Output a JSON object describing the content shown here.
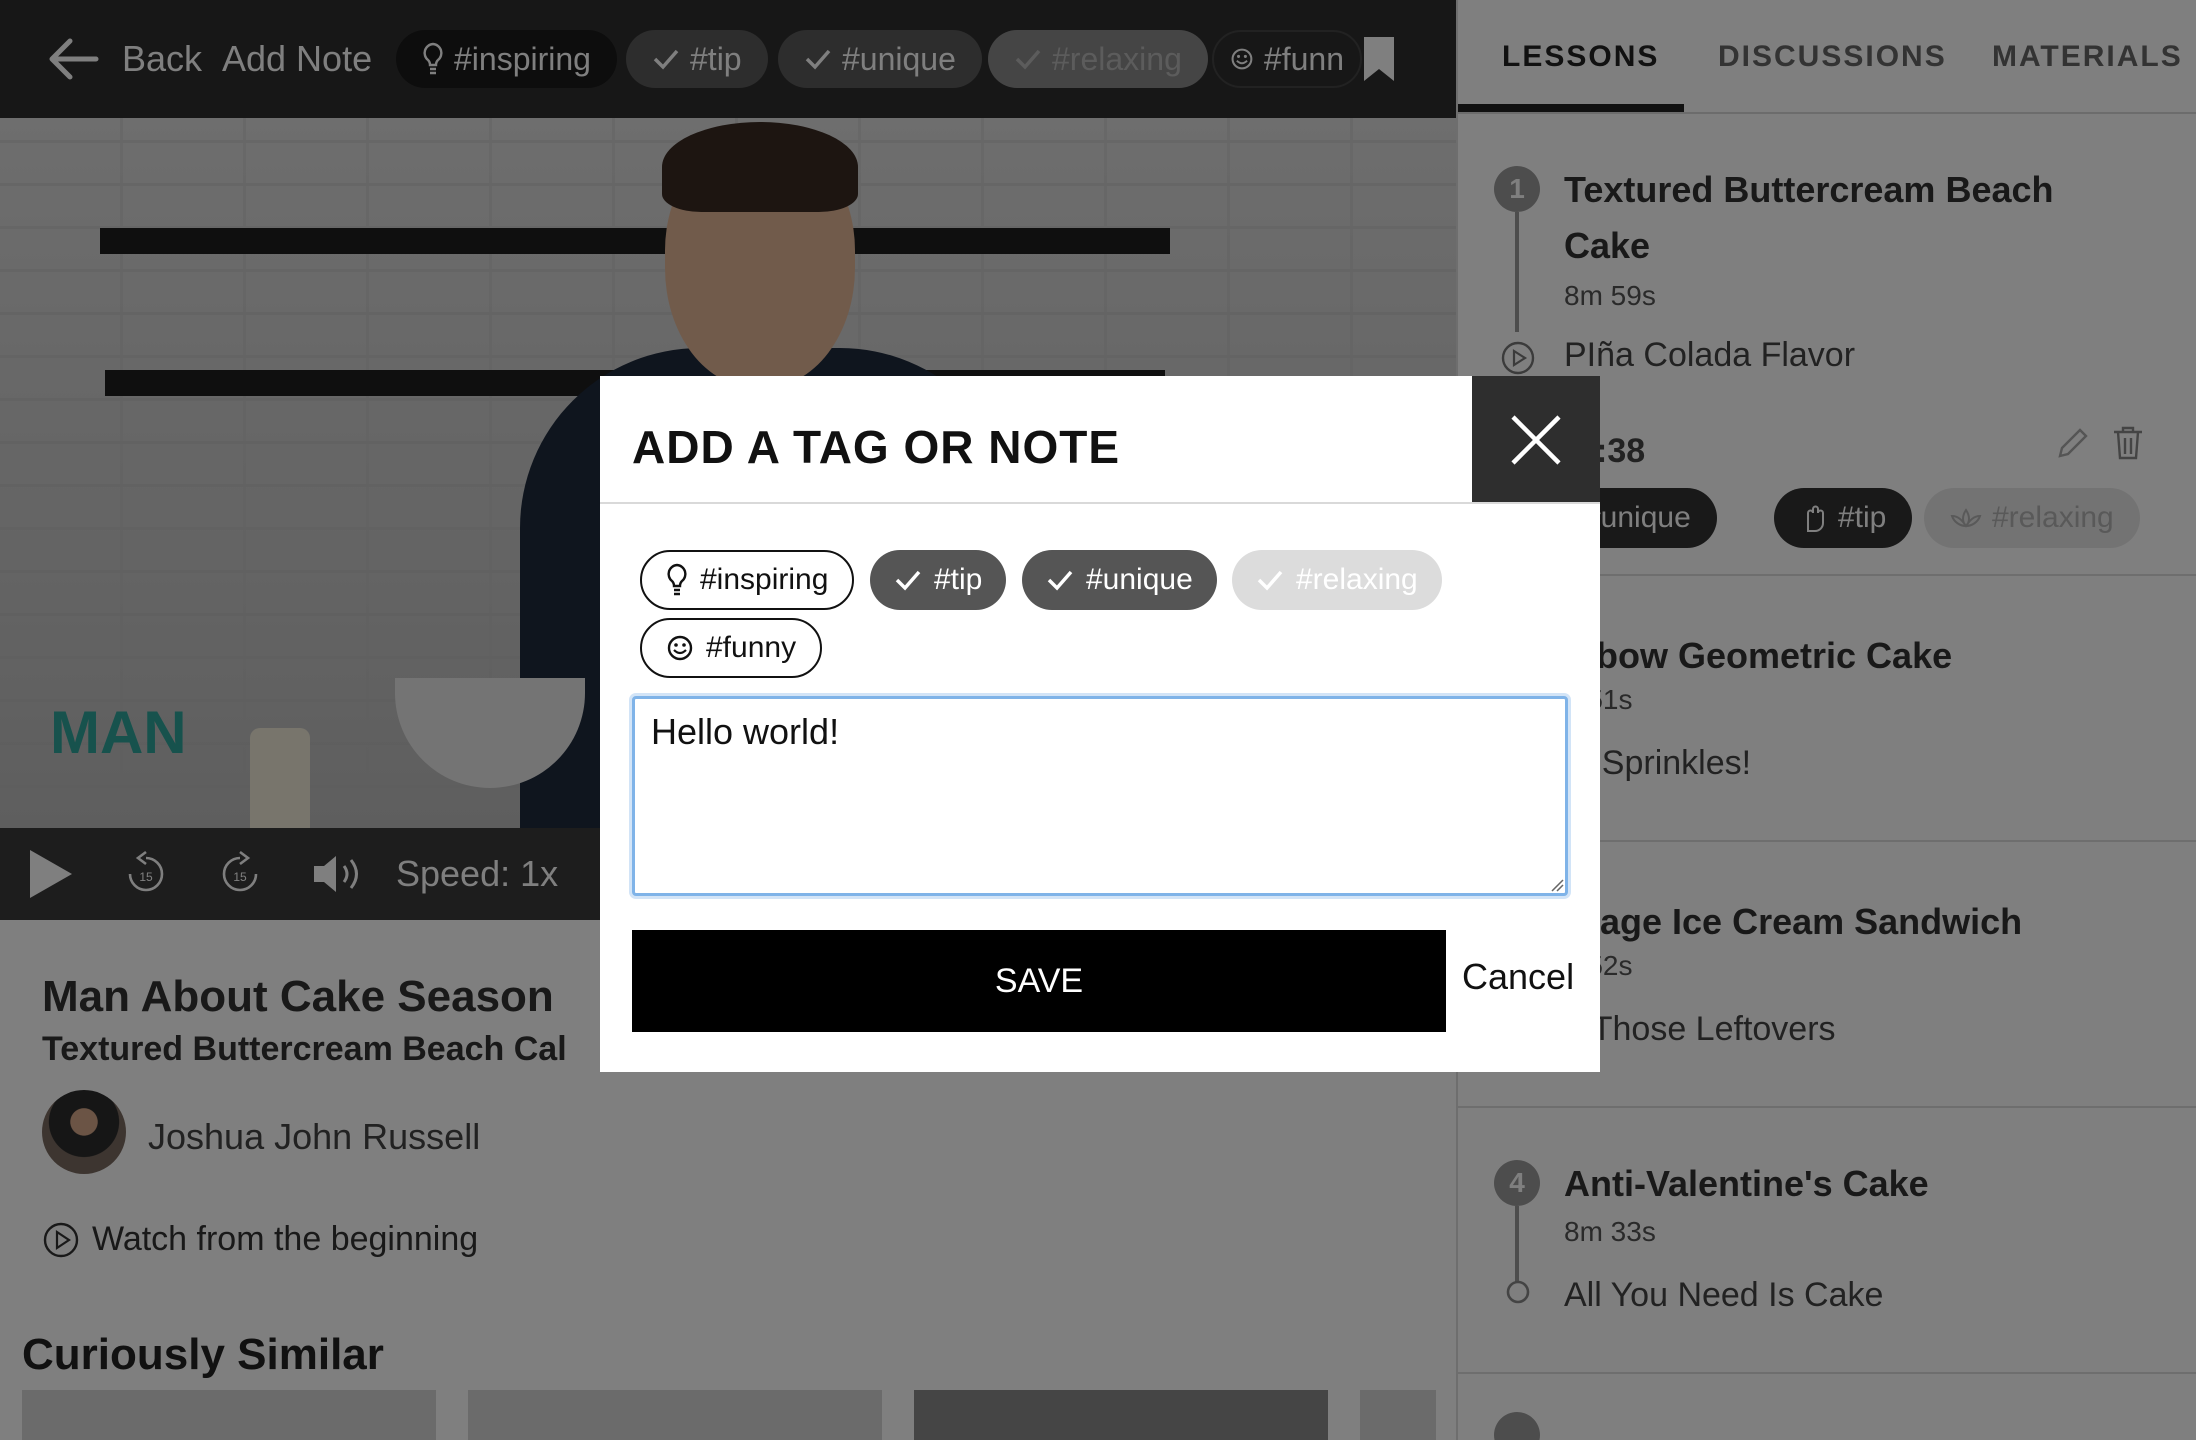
{
  "topbar": {
    "back_label": "Back",
    "add_note_label": "Add Note",
    "tags": [
      {
        "label": "#inspiring",
        "icon": "lightbulb-icon",
        "state": "active"
      },
      {
        "label": "#tip",
        "icon": "check-icon",
        "state": "selected"
      },
      {
        "label": "#unique",
        "icon": "check-icon",
        "state": "selected"
      },
      {
        "label": "#relaxing",
        "icon": "check-icon",
        "state": "disabled"
      },
      {
        "label": "#funn",
        "icon": "smiley-icon",
        "state": "default"
      }
    ]
  },
  "player": {
    "speed_label": "Speed: 1x",
    "skip_back_seconds": "15",
    "skip_forward_seconds": "15",
    "progress_fraction": 0.12
  },
  "info": {
    "show_title": "Man About Cake Season",
    "episode_title": "Textured Buttercream Beach Cal",
    "author": "Joshua John Russell",
    "watch_from_beginning": "Watch from the beginning",
    "similar_heading": "Curiously Similar"
  },
  "sidebar": {
    "tabs": [
      "LESSONS",
      "DISCUSSIONS",
      "MATERIALS"
    ],
    "active_tab": "LESSONS",
    "lessons": [
      {
        "number": "1",
        "title": "Textured Buttercream Beach Cake",
        "duration": "8m 59s",
        "subtitle": "PIña Colada Flavor"
      },
      {
        "number": "",
        "title": "inbow Geometric Cake",
        "duration": "1 51s",
        "subtitle": "th Sprinkles!"
      },
      {
        "number": "",
        "title": "rbage Ice Cream Sandwich",
        "duration": "1 52s",
        "subtitle": "e Those Leftovers"
      },
      {
        "number": "4",
        "title": "Anti-Valentine's Cake",
        "duration": "8m 33s",
        "subtitle": "All You Need Is Cake"
      }
    ],
    "note_time": ":38",
    "note_tags": [
      "#unique",
      "#tip",
      "#relaxing"
    ]
  },
  "modal": {
    "title": "ADD A TAG OR NOTE",
    "tags": [
      {
        "label": "#inspiring",
        "icon": "lightbulb-icon",
        "state": "outline"
      },
      {
        "label": "#tip",
        "icon": "check-icon",
        "state": "selected"
      },
      {
        "label": "#unique",
        "icon": "check-icon",
        "state": "selected"
      },
      {
        "label": "#relaxing",
        "icon": "check-icon",
        "state": "disabled"
      },
      {
        "label": "#funny",
        "icon": "smiley-icon",
        "state": "outline"
      }
    ],
    "note_value": "Hello world!",
    "save_label": "SAVE",
    "cancel_label": "Cancel"
  },
  "colors": {
    "overlay": "#000000",
    "focus_ring": "#7fb3e8",
    "save_bg": "#000000",
    "chip_selected": "#555555",
    "chip_disabled": "#dcdcdc"
  }
}
